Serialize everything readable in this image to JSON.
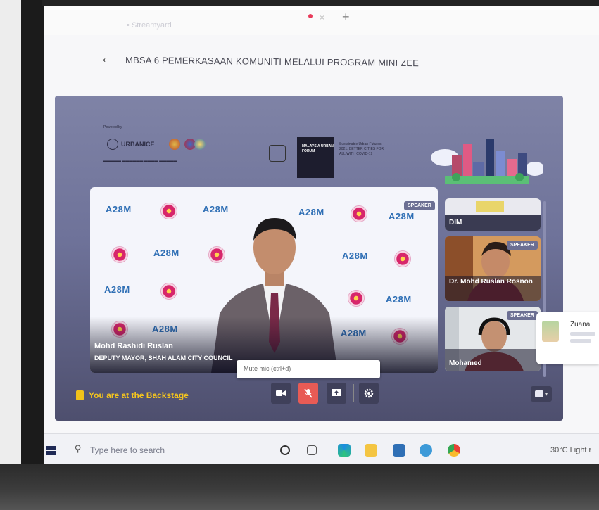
{
  "browser": {
    "tab_label": "• Streamyard",
    "tab_close": "×",
    "new_tab": "+"
  },
  "header": {
    "back_arrow": "←",
    "event_title": "MBSA 6 PEMERKASAAN KOMUNITI MELALUI PROGRAM MINI ZEE"
  },
  "banner": {
    "powered_by": "Powered by",
    "urbanice": "URBANICE",
    "muf_text": "MALAYSIA URBAN FORUM",
    "theme": "Sustainable Urban Futures 2021: BETTER CITIES FOR ALL WITH COVID-19"
  },
  "main_video": {
    "speaker_badge": "SPEAKER",
    "backdrop_logo": "A28M",
    "name": "Mohd Rashidi Ruslan",
    "role": "DEPUTY MAYOR, SHAH ALAM CITY COUNCIL"
  },
  "side_tiles": [
    {
      "name": "DIM",
      "badge": ""
    },
    {
      "name": "Dr. Mohd Ruslan Rosnon",
      "badge": "SPEAKER"
    },
    {
      "name": "Mohamed",
      "badge": "SPEAKER"
    }
  ],
  "controls": {
    "backstage_text": "You are at the Backstage",
    "tooltip": "Mute mic (ctrl+d)",
    "camera": "camera",
    "mic": "mic-muted",
    "share": "share",
    "settings": "settings"
  },
  "chat": {
    "name": "Zuana"
  },
  "taskbar": {
    "search_placeholder": "Type here to search",
    "weather": "30°C Light r"
  },
  "colors": {
    "stage": "#6e7299",
    "backstage_yellow": "#f5c51e",
    "mic_red": "#e85b55",
    "badge": "#6c6f93"
  }
}
